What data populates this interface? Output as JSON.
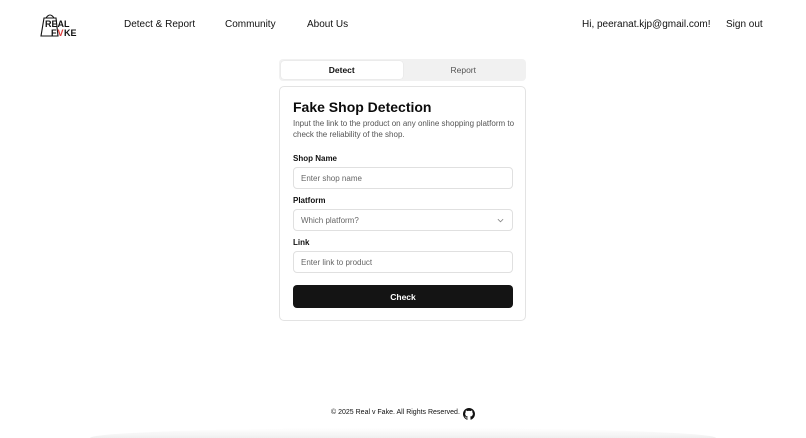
{
  "logo": {
    "line1": "REAL",
    "line2": "FVKE",
    "accent_color": "#e03a3a"
  },
  "nav": {
    "links": [
      "Detect & Report",
      "Community",
      "About Us"
    ],
    "greeting": "Hi, peeranat.kjp@gmail.com!",
    "sign_out": "Sign out"
  },
  "tabs": [
    {
      "label": "Detect",
      "active": true
    },
    {
      "label": "Report",
      "active": false
    }
  ],
  "card": {
    "title": "Fake Shop Detection",
    "description": "Input the link to the product on any online shopping platform to check the reliability of the shop.",
    "shop_name": {
      "label": "Shop Name",
      "placeholder": "Enter shop name",
      "value": ""
    },
    "platform": {
      "label": "Platform",
      "placeholder": "Which platform?",
      "icon": "chevron-down-icon"
    },
    "link": {
      "label": "Link",
      "placeholder": "Enter link to product",
      "value": ""
    },
    "check_label": "Check"
  },
  "footer": {
    "text": "© 2025 Real v Fake. All Rights Reserved.",
    "icon": "github-icon"
  }
}
